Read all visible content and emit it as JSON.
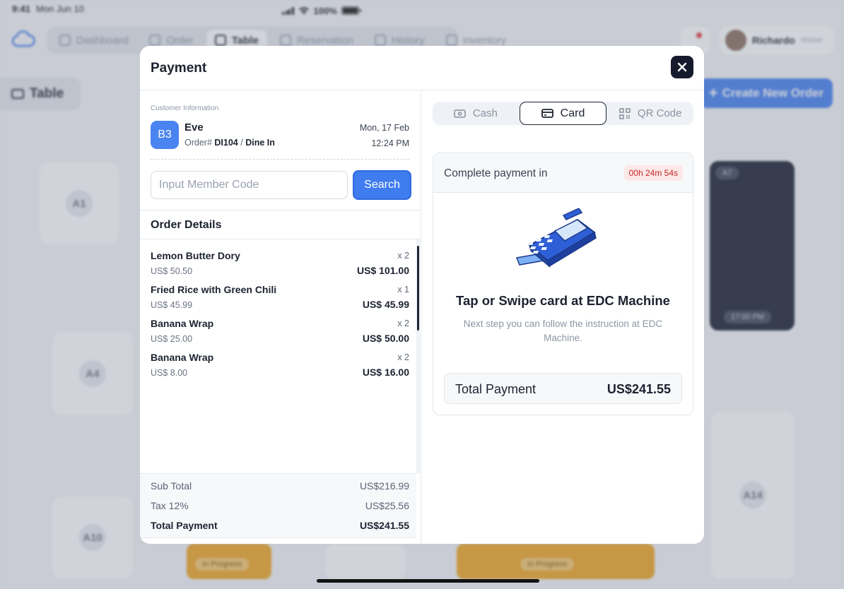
{
  "status_bar": {
    "time": "9:41",
    "date": "Mon Jun 10",
    "battery": "100%"
  },
  "nav": {
    "items": [
      {
        "label": "Dashboard",
        "active": false
      },
      {
        "label": "Order",
        "active": false
      },
      {
        "label": "Table",
        "active": true
      },
      {
        "label": "Reservation",
        "active": false
      },
      {
        "label": "History",
        "active": false
      },
      {
        "label": "Inventory",
        "active": false
      }
    ],
    "user": {
      "name": "Richardo",
      "role": "Waiter"
    }
  },
  "page": {
    "title": "Table",
    "create_button": "Create New Order"
  },
  "tables": {
    "a1": "A1",
    "a4": "A4",
    "a7": "A7",
    "a10": "A10",
    "a14": "A14",
    "a7_time": "17:00 PM",
    "in_progress": "In Progress"
  },
  "modal": {
    "title": "Payment",
    "customer": {
      "caption": "Customer Information",
      "badge": "B3",
      "name": "Eve",
      "order_prefix": "Order#",
      "order_id": "DI104",
      "separator": "/",
      "type": "Dine In",
      "date": "Mon, 17 Feb",
      "time": "12:24 PM"
    },
    "member": {
      "placeholder": "Input Member Code",
      "value": "",
      "search_label": "Search"
    },
    "order_details_title": "Order Details",
    "items": [
      {
        "name": "Lemon Butter Dory",
        "price": "US$ 50.50",
        "qty": "x 2",
        "total": "US$ 101.00"
      },
      {
        "name": "Fried Rice with Green Chili",
        "price": "US$ 45.99",
        "qty": "x 1",
        "total": "US$ 45.99"
      },
      {
        "name": "Banana Wrap",
        "price": "US$ 25.00",
        "qty": "x 2",
        "total": "US$ 50.00"
      },
      {
        "name": "Banana Wrap",
        "price": "US$ 8.00",
        "qty": "x 2",
        "total": "US$ 16.00"
      }
    ],
    "summary": {
      "subtotal_label": "Sub Total",
      "subtotal": "US$216.99",
      "tax_label": "Tax 12%",
      "tax": "US$25.56",
      "total_label": "Total Payment",
      "total": "US$241.55"
    },
    "payment": {
      "tabs": [
        {
          "label": "Cash",
          "icon": "cash-icon",
          "active": false
        },
        {
          "label": "Card",
          "icon": "card-icon",
          "active": true
        },
        {
          "label": "QR Code",
          "icon": "qr-code-icon",
          "active": false
        }
      ],
      "countdown_label": "Complete payment in",
      "countdown": "00h 24m 54s",
      "heading": "Tap or Swipe card at EDC Machine",
      "instruction": "Next step you can follow the instruction at EDC Machine.",
      "total_label": "Total Payment",
      "total": "US$241.55"
    }
  },
  "colors": {
    "accent": "#3f7cf0",
    "dark": "#151b2c",
    "warning": "#f0a31c",
    "danger": "#c62828"
  }
}
